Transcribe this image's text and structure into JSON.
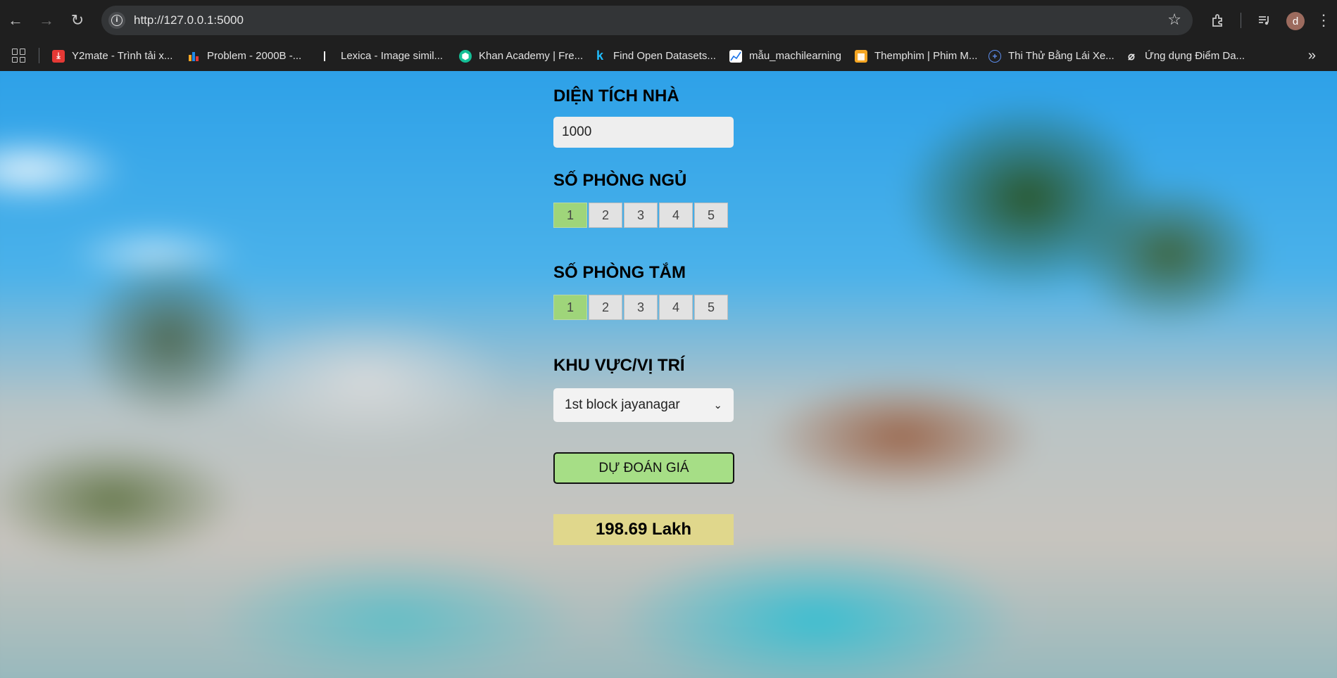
{
  "browser": {
    "url": "http://127.0.0.1:5000",
    "profile_initial": "d",
    "bookmarks": [
      {
        "label": "Y2mate - Trình tải x...",
        "icon": "download-icon",
        "color": "#e53935"
      },
      {
        "label": "Problem - 2000B -...",
        "icon": "codeforces-icon",
        "color": "#1e88e5"
      },
      {
        "label": "Lexica - Image simil...",
        "icon": "lexica-icon",
        "color": "#ffffff"
      },
      {
        "label": "Khan Academy | Fre...",
        "icon": "khan-academy-icon",
        "color": "#14bf96"
      },
      {
        "label": "Find Open Datasets...",
        "icon": "kaggle-icon",
        "color": "#20beff"
      },
      {
        "label": "mẫu_machilearning",
        "icon": "chart-icon",
        "color": "#ffffff"
      },
      {
        "label": "Themphim | Phim M...",
        "icon": "film-icon",
        "color": "#f5a623"
      },
      {
        "label": "Thi Thử Bằng Lái Xe...",
        "icon": "globe-icon",
        "color": "#5c8ded"
      },
      {
        "label": "Ứng dụng Điểm Da...",
        "icon": "app-icon",
        "color": "#e3e3e3"
      }
    ]
  },
  "form": {
    "area_label": "DIỆN TÍCH NHÀ",
    "area_value": "1000",
    "bedrooms_label": "SỐ PHÒNG NGỦ",
    "bedroom_options": [
      "1",
      "2",
      "3",
      "4",
      "5"
    ],
    "bedrooms_selected": "1",
    "bathrooms_label": "SỐ PHÒNG TẮM",
    "bathroom_options": [
      "1",
      "2",
      "3",
      "4",
      "5"
    ],
    "bathrooms_selected": "1",
    "location_label": "KHU VỰC/VỊ TRÍ",
    "location_value": "1st block jayanagar",
    "predict_label": "DỰ ĐOÁN GIÁ",
    "result": "198.69 Lakh"
  },
  "colors": {
    "selected_segment": "#9fd57a",
    "predict_button": "#a6de86",
    "result_box": "#e0d78c"
  }
}
